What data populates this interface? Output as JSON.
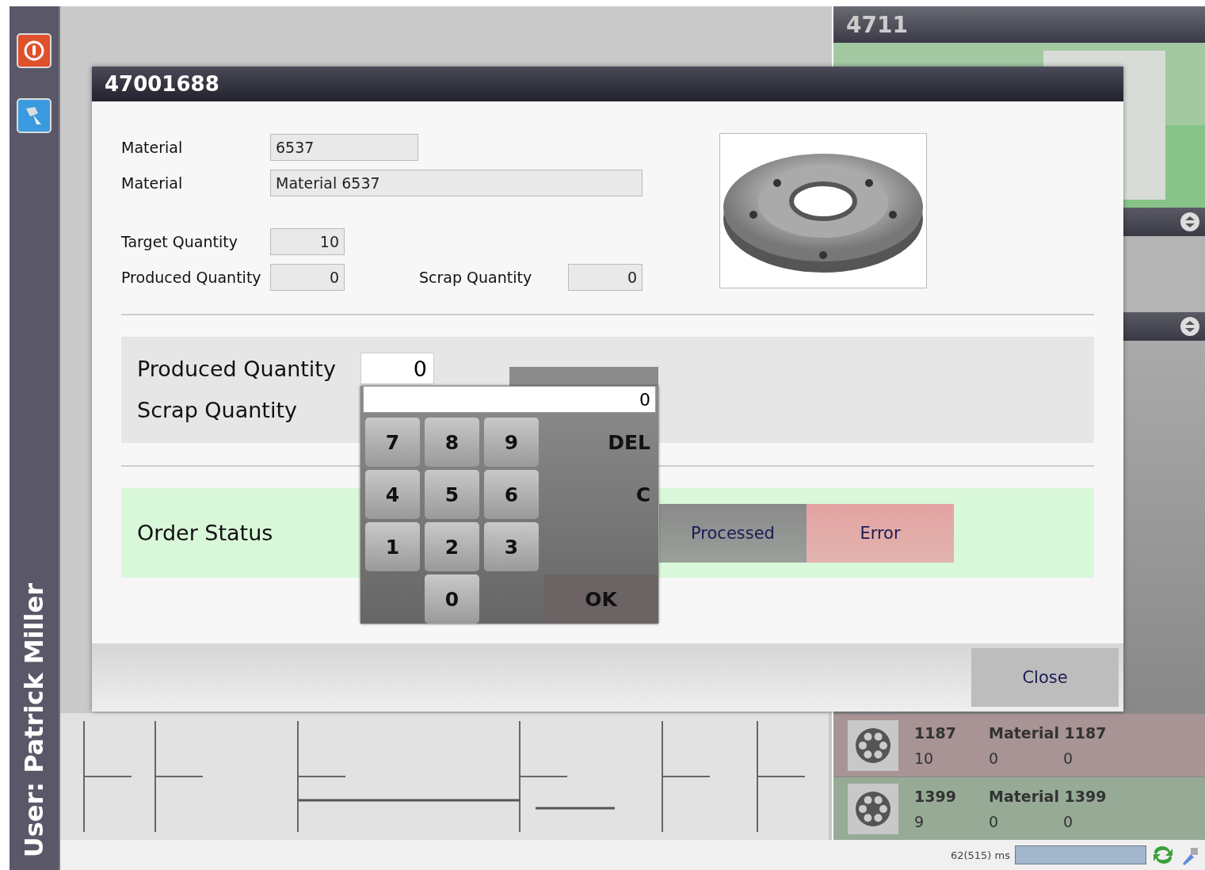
{
  "sidebar": {
    "user_label": "User: Patrick Miller"
  },
  "machine_panel": {
    "title": "4711",
    "orders": [
      {
        "number": "1187",
        "material": "Material 1187",
        "column_3": "10",
        "column_4": "0",
        "column_5": "0",
        "color": "#a89494"
      },
      {
        "number": "1399",
        "material": "Material 1399",
        "column_3": "9",
        "column_4": "0",
        "column_5": "0",
        "color": "#96aa96"
      }
    ]
  },
  "dialog": {
    "title": "47001688",
    "material_label": "Material",
    "material_value": "6537",
    "description_label": "Material",
    "description_value": "Material 6537",
    "target_label": "Target Quantity",
    "target_value": "10",
    "produced_label": "Produced Quantity",
    "produced_value": "0",
    "scrap_label": "Scrap Quantity",
    "scrap_value": "0",
    "entry": {
      "produced_label": "Produced Quantity",
      "produced_value": "0",
      "scrap_label": "Scrap Quantity"
    },
    "status": {
      "label": "Order Status",
      "options": [
        {
          "label": "Processed",
          "selected": false,
          "color": "#8a8a8a"
        },
        {
          "label": "Error",
          "selected": false,
          "color": "#e4a3a3"
        }
      ]
    },
    "close_label": "Close"
  },
  "keypad": {
    "value": "0",
    "rows": [
      [
        "7",
        "8",
        "9",
        "DEL"
      ],
      [
        "4",
        "5",
        "6",
        "C"
      ],
      [
        "1",
        "2",
        "3",
        ""
      ],
      [
        "",
        "0",
        "",
        "OK"
      ]
    ]
  },
  "status_bar": {
    "timing": "62(515) ms"
  }
}
